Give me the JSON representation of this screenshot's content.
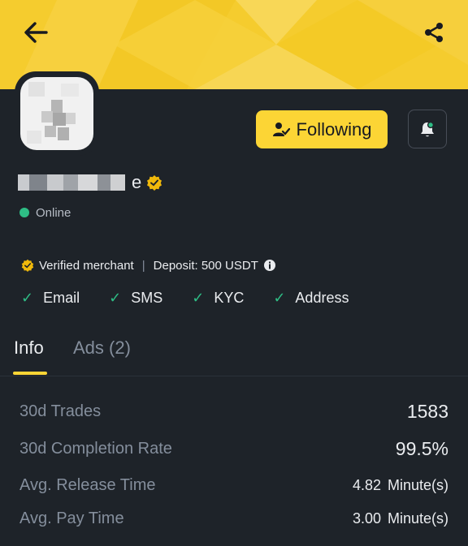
{
  "header": {
    "back_icon": "arrow-left-icon",
    "share_icon": "share-icon",
    "banner_color": "#f5cc2e"
  },
  "profile": {
    "name_visible": "e",
    "status": "Online",
    "status_color": "#2ebd85",
    "verified_badge_color": "#f0b90b",
    "follow_label": "Following",
    "bell_icon": "bell-notification-icon"
  },
  "merchant": {
    "badge_label": "Verified merchant",
    "separator": "|",
    "deposit": "Deposit: 500 USDT",
    "info_icon": "info-icon"
  },
  "verifications": [
    {
      "label": "Email"
    },
    {
      "label": "SMS"
    },
    {
      "label": "KYC"
    },
    {
      "label": "Address"
    }
  ],
  "tabs": [
    {
      "label": "Info",
      "active": true
    },
    {
      "label": "Ads (2)",
      "active": false
    }
  ],
  "stats": [
    {
      "label": "30d Trades",
      "value": "1583"
    },
    {
      "label": "30d Completion Rate",
      "value": "99.5%"
    },
    {
      "label": "Avg. Release Time",
      "value": "4.82",
      "unit": "Minute(s)"
    },
    {
      "label": "Avg. Pay Time",
      "value": "3.00",
      "unit": "Minute(s)"
    }
  ],
  "colors": {
    "accent": "#fcd535",
    "background": "#1e2329",
    "success": "#2ebd85",
    "muted_text": "#848e9c"
  }
}
